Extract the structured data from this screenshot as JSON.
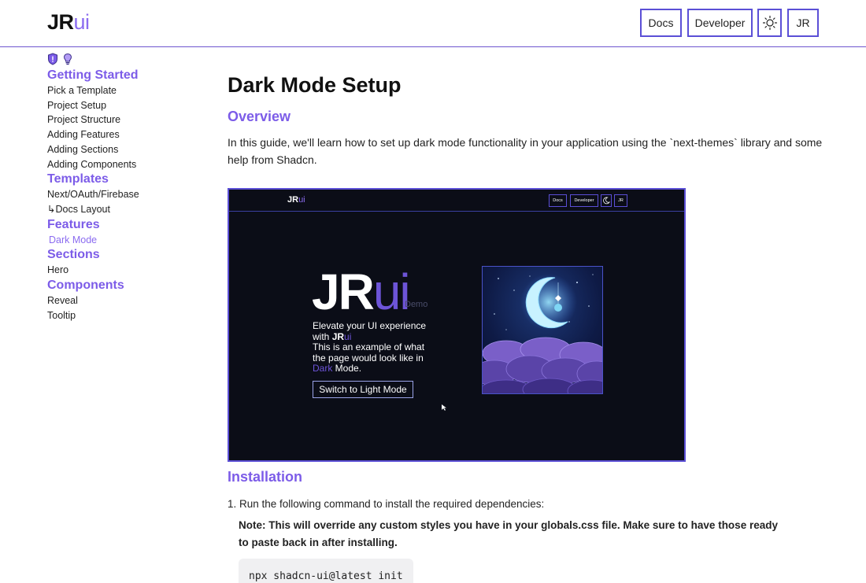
{
  "header": {
    "logo_bold": "JR",
    "logo_light": "ui",
    "nav": {
      "docs": "Docs",
      "developer": "Developer",
      "theme_icon": "sun-icon",
      "avatar": "JR"
    }
  },
  "sidebar": {
    "icons": [
      "shield-icon",
      "lightbulb-icon"
    ],
    "sections": [
      {
        "title": "Getting Started",
        "items": [
          "Pick a Template",
          "Project Setup",
          "Project Structure",
          "Adding Features",
          "Adding Sections",
          "Adding Components"
        ]
      },
      {
        "title": "Templates",
        "items": [
          "Next/OAuth/Firebase",
          "↳Docs Layout"
        ]
      },
      {
        "title": "Features",
        "items": [
          "Dark Mode"
        ]
      },
      {
        "title": "Sections",
        "items": [
          "Hero"
        ]
      },
      {
        "title": "Components",
        "items": [
          "Reveal",
          "Tooltip"
        ]
      }
    ],
    "active_item": "Dark Mode"
  },
  "main": {
    "title": "Dark Mode Setup",
    "overview_heading": "Overview",
    "overview_text": "In this guide, we'll learn how to set up dark mode functionality in your application using the `next-themes` library and some help from Shadcn.",
    "screenshot": {
      "logo_bold": "JR",
      "logo_light": "ui",
      "nav": {
        "docs": "Docs",
        "developer": "Developer",
        "theme_icon": "moon-icon",
        "avatar": "JR"
      },
      "hero_bold": "JR",
      "hero_light": "ui",
      "hero_sub": "Demo",
      "line1": "Elevate your UI experience",
      "line2_prefix": "with ",
      "line2_bold": "JR",
      "line2_light": "ui",
      "line3": "This is an example of what",
      "line4": "the page would look like in",
      "line5_accent": "Dark",
      "line5_rest": " Mode.",
      "button": "Switch to Light Mode",
      "image": "crescent-moon-night-clouds-illustration"
    },
    "installation_heading": "Installation",
    "step1": "1. Run the following command to install the required dependencies:",
    "note": "Note: This will override any custom styles you have in your globals.css file. Make sure to have those ready to paste back in after installing.",
    "command": "npx shadcn-ui@latest init"
  },
  "colors": {
    "accent": "#7c5ce8",
    "border": "#5b4fd6",
    "dark_bg": "#0b0d17"
  }
}
